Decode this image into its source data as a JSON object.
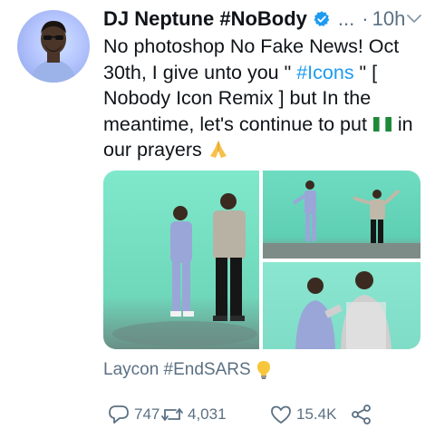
{
  "tweet": {
    "author_name": "DJ Neptune #NoBody",
    "ellipsis": "...",
    "time_prefix": "·",
    "time": "10h",
    "text_part1": "No photoshop No Fake News! Oct 30th, I give unto you  \" ",
    "hashtag_icons": "#Icons",
    "text_part2": " \" [ Nobody Icon Remix ] but In the meantime, let's continue to put ",
    "text_part3": " in our prayers ",
    "flag_icon": "nigeria-flag-emoji",
    "pray_icon": "folded-hands-emoji",
    "caption": "Laycon #EndSARS",
    "caption_icon": "lightbulb-emoji"
  },
  "actions": {
    "reply_count": "747",
    "retweet_count": "4,031",
    "like_count": "15.4K"
  },
  "colors": {
    "link": "#1d9bf0",
    "secondary_text": "#5b7083",
    "verified": "#1d9bf0",
    "studio_green": "#7fe0c6"
  }
}
